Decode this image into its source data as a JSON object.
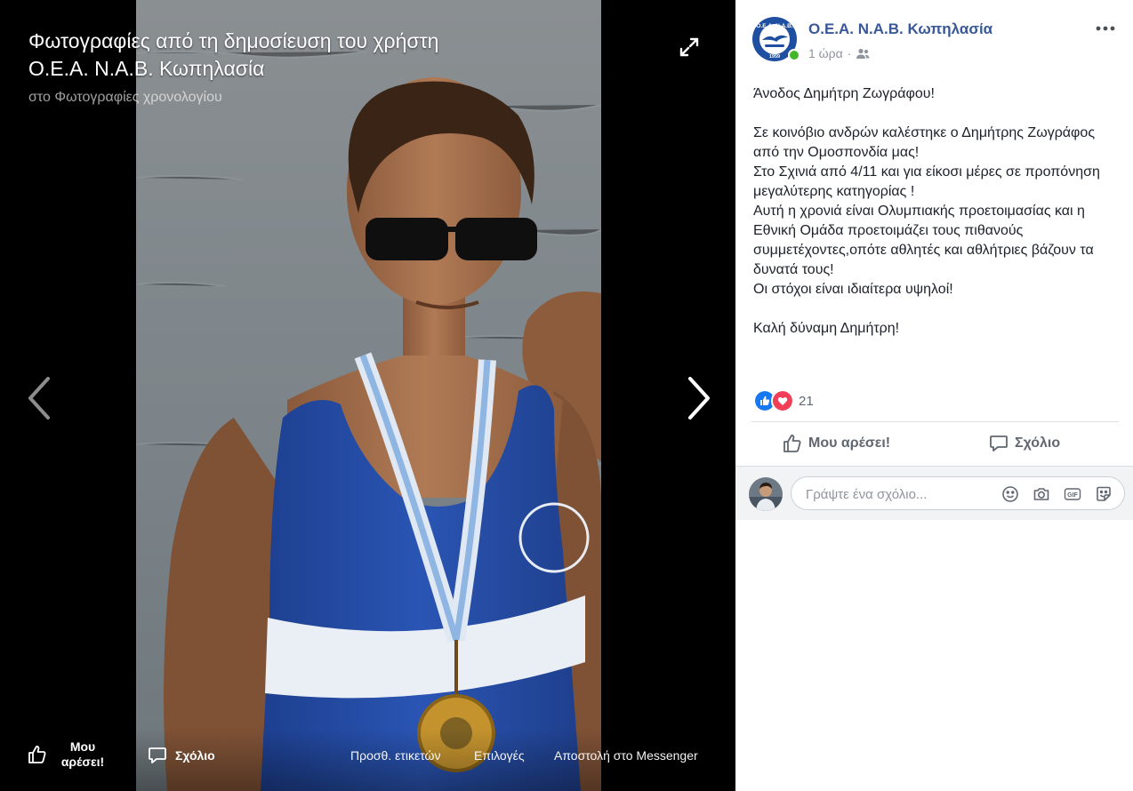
{
  "viewer": {
    "title": "Φωτογραφίες από τη δημοσίευση του χρήστη Ο.Ε.Α. Ν.Α.Β. Κωπηλασία",
    "subtitle": "στο Φωτογραφίες χρονολογίου",
    "photo_alt": "photo",
    "footer": {
      "like_label": "Μου αρέσει!",
      "comment_label": "Σχόλιο",
      "tag_label": "Προσθ. ετικετών",
      "options_label": "Επιλογές",
      "messenger_label": "Αποστολή στο Messenger"
    },
    "icons": [
      "expand-icon",
      "chevron-left-icon",
      "chevron-right-icon",
      "thumbs-up-icon",
      "comment-icon"
    ]
  },
  "post": {
    "page_name": "Ο.Ε.Α. Ν.Α.Β. Κωπηλασία",
    "time": "1 ώρα",
    "separator": "·",
    "audience_icon": "friends-icon",
    "body": [
      "Άνοδος Δημήτρη Ζωγράφου!",
      "",
      "Σε κοινόβιο ανδρών καλέστηκε ο Δημήτρης Ζωγράφος από την Ομοσπονδία μας!",
      "Στο Σχινιά από 4/11 και για είκοσι μέρες σε προπόνηση μεγαλύτερης κατηγορίας !",
      "Αυτή η χρονιά είναι Ολυμπιακής προετοιμασίας και η Εθνική Ομάδα προετοιμάζει τους πιθανούς συμμετέχοντες,οπότε αθλητές και αθλήτριες βάζουν τα δυνατά τους!",
      "Οι στόχοι είναι ιδιαίτερα υψηλοί!",
      "",
      "Καλή δύναμη Δημήτρη!"
    ],
    "reactions": {
      "count": "21",
      "types": [
        "like",
        "love"
      ]
    },
    "actions": {
      "like_label": "Μου αρέσει!",
      "comment_label": "Σχόλιο"
    },
    "comment_box": {
      "placeholder": "Γράψτε ένα σχόλιο...",
      "icons": [
        "emoji-icon",
        "camera-icon",
        "gif-icon",
        "sticker-icon"
      ]
    }
  },
  "colors": {
    "link_blue": "#385898",
    "like_blue": "#1877f2",
    "love_red": "#f33e58",
    "online_green": "#42b72a",
    "muted_text": "#90949c",
    "action_text": "#606770"
  }
}
